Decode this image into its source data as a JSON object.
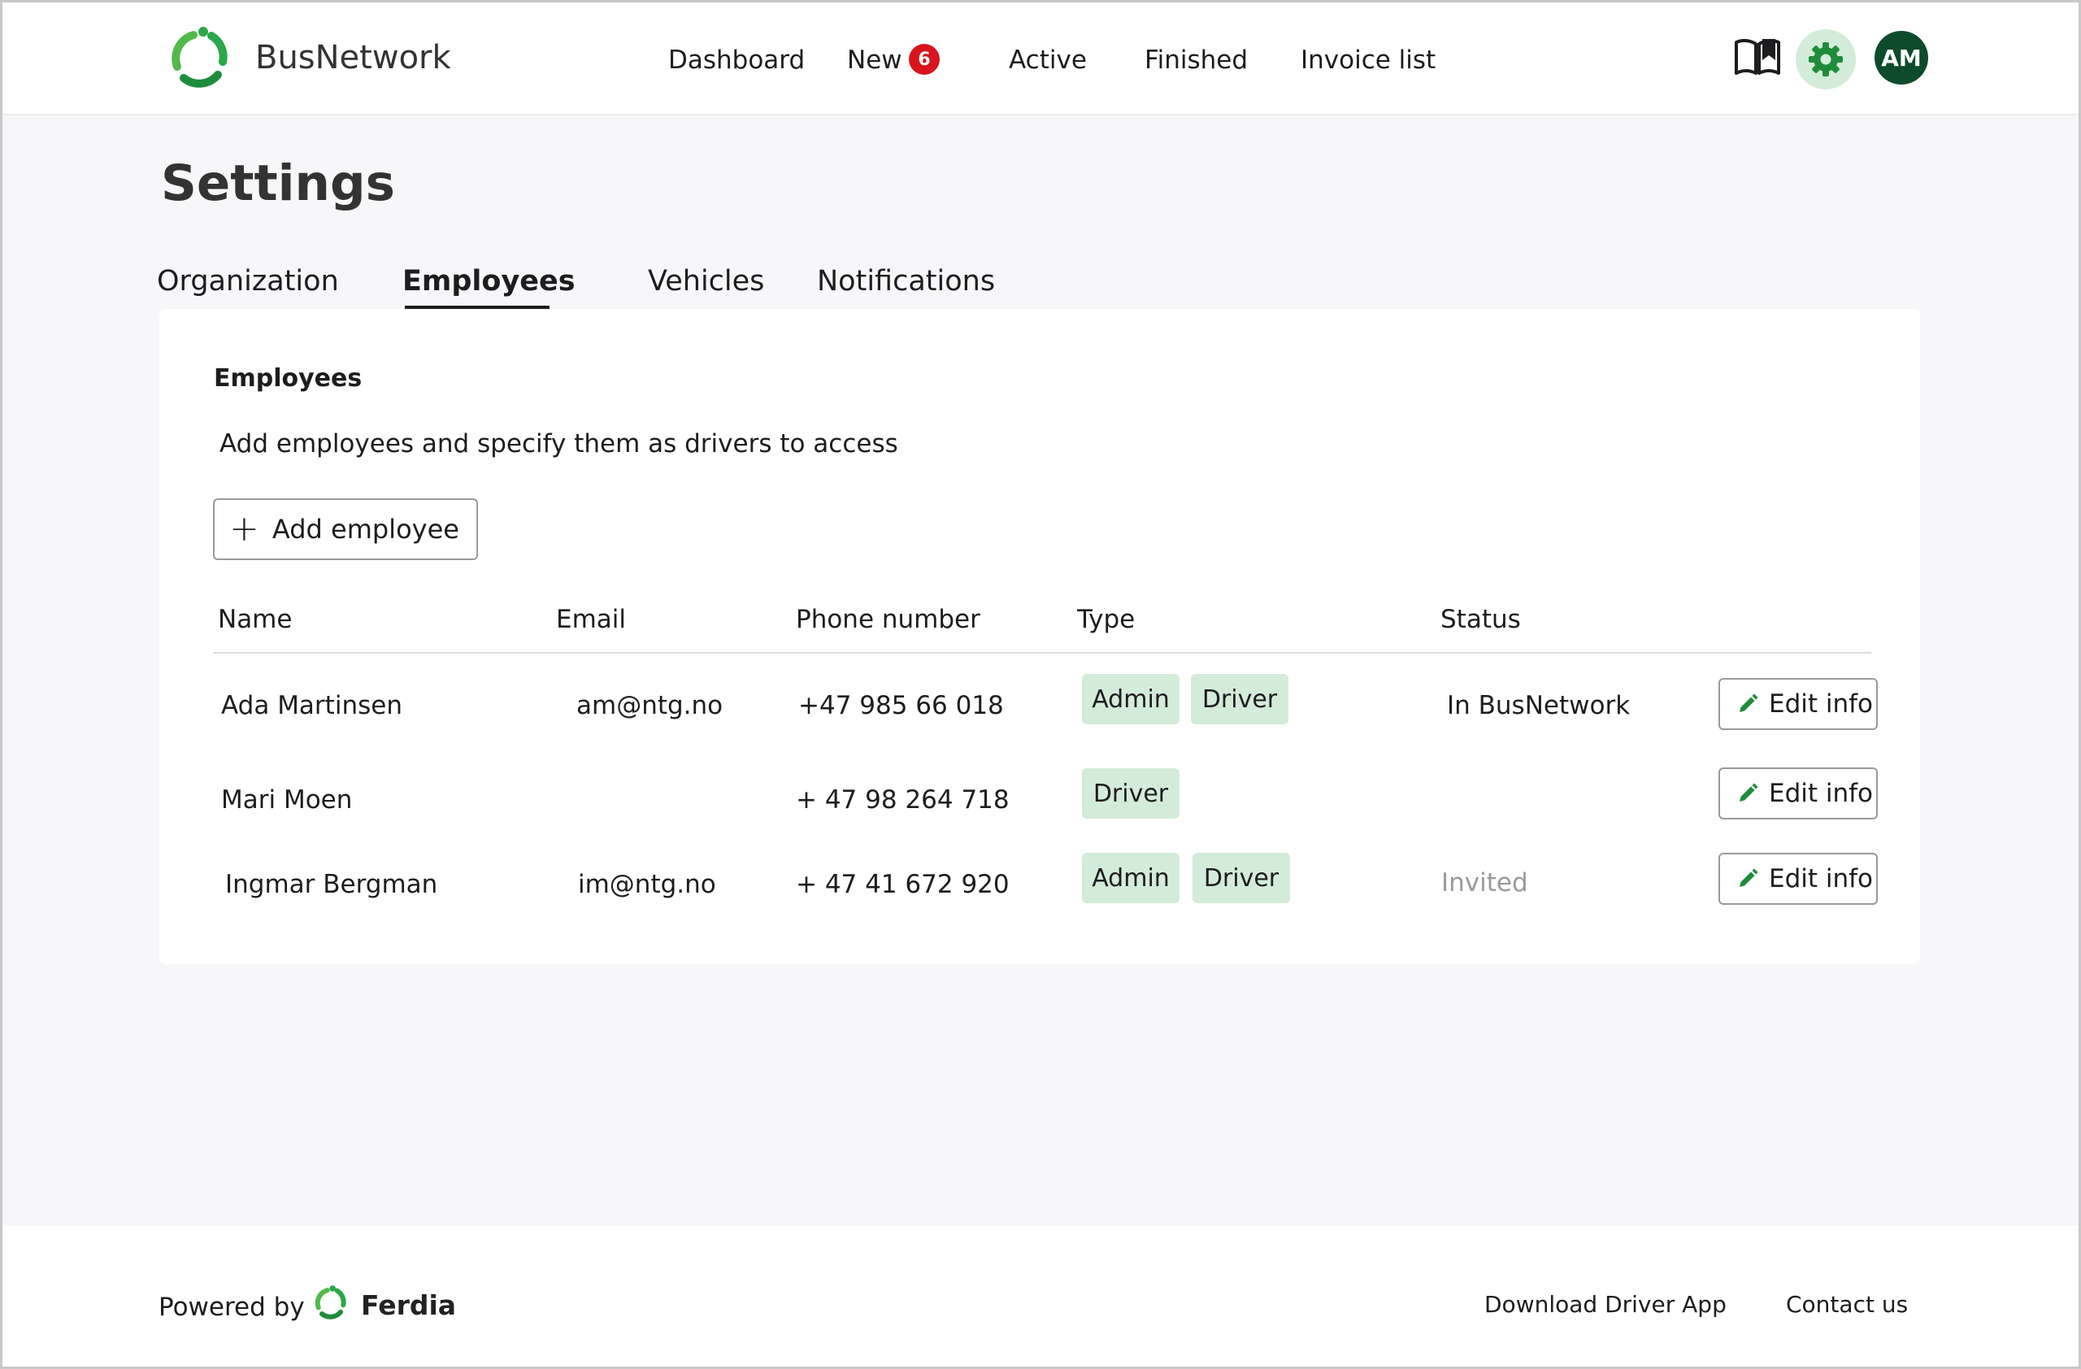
{
  "header": {
    "brand": "BusNetwork",
    "nav": {
      "dashboard": "Dashboard",
      "new": "New",
      "new_count": "6",
      "active": "Active",
      "finished": "Finished",
      "invoice_list": "Invoice list"
    },
    "avatar_initials": "AM",
    "icons": [
      "book-icon",
      "gear-icon"
    ]
  },
  "page": {
    "title": "Settings",
    "tabs": {
      "organization": "Organization",
      "employees": "Employees",
      "vehicles": "Vehicles",
      "notifications": "Notifications"
    },
    "active_tab": "Employees"
  },
  "employees": {
    "title": "Employees",
    "description": "Add employees and specify them as drivers to access",
    "add_button": "Add employee",
    "columns": {
      "name": "Name",
      "email": "Email",
      "phone": "Phone number",
      "type": "Type",
      "status": "Status"
    },
    "rows": [
      {
        "name": "Ada Martinsen",
        "email": "am@ntg.no",
        "phone": "+47 985 66 018",
        "types": [
          "Admin",
          "Driver"
        ],
        "status": "In BusNetwork",
        "edit": "Edit info"
      },
      {
        "name": "Mari Moen",
        "email": "",
        "phone": "+ 47 98 264 718",
        "types": [
          "Driver"
        ],
        "status": "",
        "edit": "Edit info"
      },
      {
        "name": "Ingmar Bergman",
        "email": "im@ntg.no",
        "phone": "+ 47 41 672 920",
        "types": [
          "Admin",
          "Driver"
        ],
        "status": "Invited",
        "edit": "Edit info"
      }
    ]
  },
  "footer": {
    "powered_by": "Powered by",
    "ferdia": "Ferdia",
    "download_driver_app": "Download Driver App",
    "contact_us": "Contact us"
  },
  "colors": {
    "accent_green": "#2aa84a",
    "tag_green": "#d3ecd9",
    "badge_red": "#d8141e",
    "avatar_dark": "#0d4b2c"
  }
}
